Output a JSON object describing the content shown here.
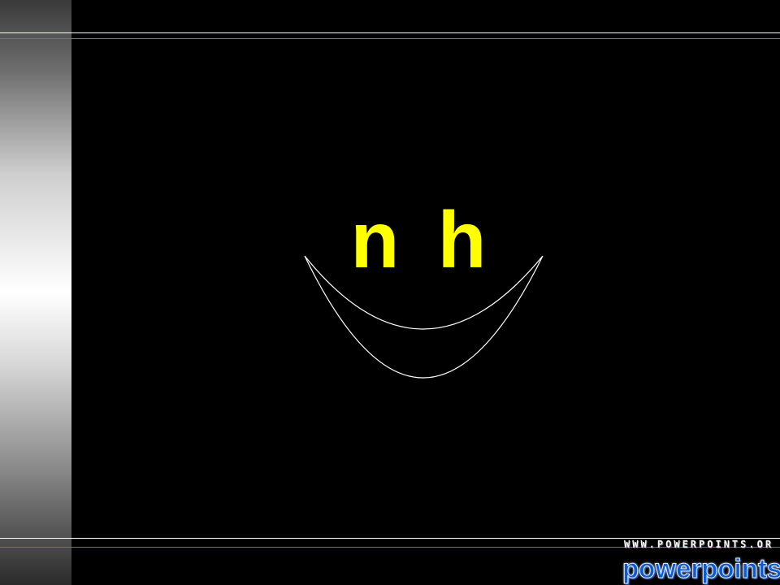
{
  "slide": {
    "background_color": "#000000",
    "title": "n h",
    "title_color": "#ffff00",
    "shape": "smile-outline",
    "shape_stroke_color": "#ffffff"
  },
  "branding": {
    "url": "WWW.POWERPOINTS.OR",
    "name": "powerpoints.or",
    "name_color": "#0a5bd8"
  }
}
